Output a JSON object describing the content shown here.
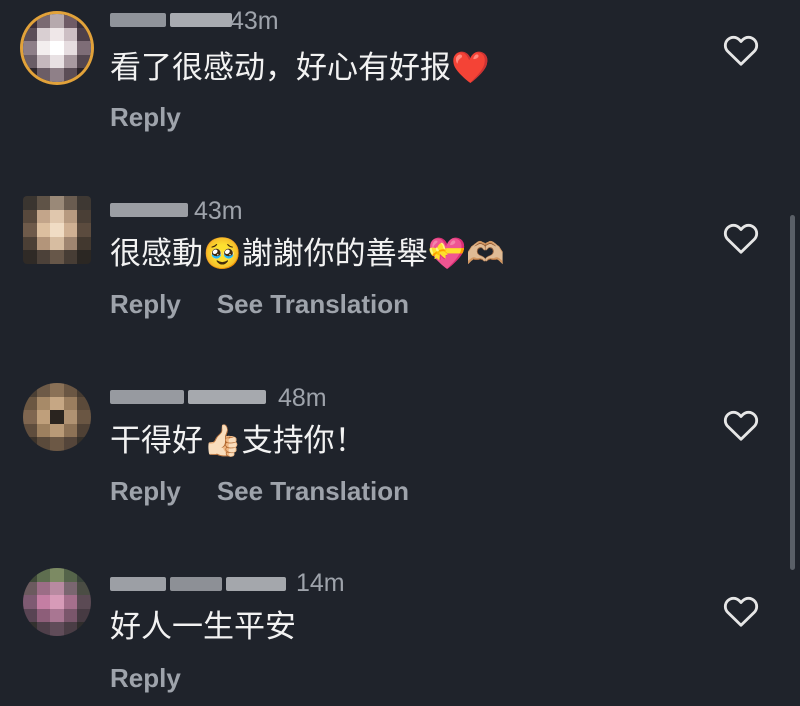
{
  "comments": [
    {
      "time": "43m",
      "text": "看了很感动，好心有好报❤️",
      "actions": {
        "reply": "Reply"
      }
    },
    {
      "time": "43m",
      "text": "很感動🥹謝謝你的善舉💝🫶🏼",
      "actions": {
        "reply": "Reply",
        "translate": "See Translation"
      }
    },
    {
      "time": "48m",
      "text": "干得好👍🏻支持你！",
      "actions": {
        "reply": "Reply",
        "translate": "See Translation"
      }
    },
    {
      "time": "14m",
      "text": "好人一生平安",
      "actions": {
        "reply": "Reply"
      }
    }
  ],
  "icons": {
    "like": "heart-outline-icon"
  },
  "colors": {
    "background": "#1f232b",
    "text": "#f2f2f2",
    "secondary": "#9ea3ab",
    "story_ring": "#e2a23a"
  }
}
